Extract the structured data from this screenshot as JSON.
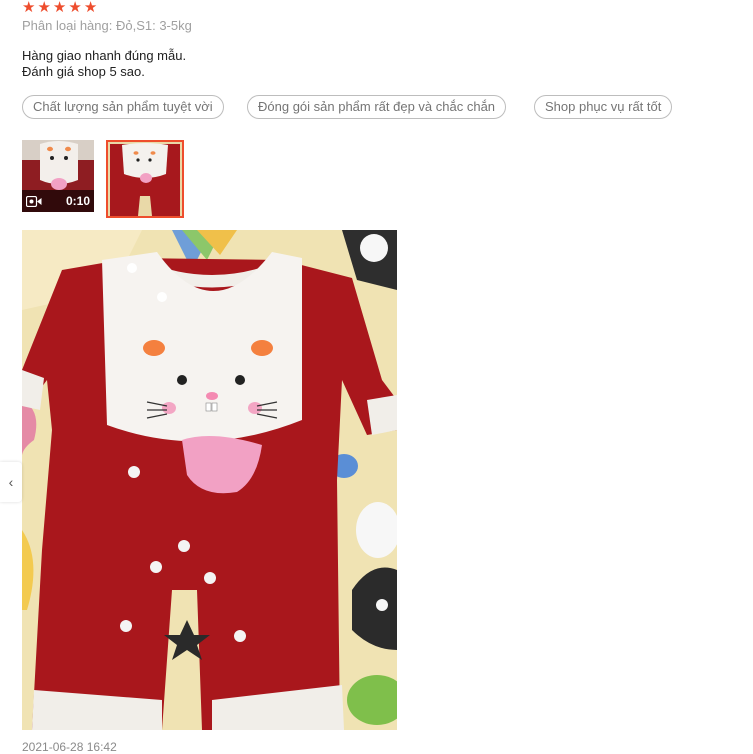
{
  "review": {
    "rating": 5,
    "stars": [
      "★",
      "★",
      "★",
      "★",
      "★"
    ],
    "variation": "Phân loại hàng: Đỏ,S1: 3-5kg",
    "comment_lines": [
      "Hàng giao nhanh đúng mẫu.",
      "Đánh giá shop 5 sao."
    ],
    "tags": [
      "Chất lượng sản phẩm tuyệt vời",
      "Đóng gói sản phẩm rất đẹp và chắc chắn",
      "Shop phục vụ rất tốt"
    ],
    "media": {
      "video_duration": "0:10",
      "video_icon": "video-camera-icon",
      "selected_index": 1
    },
    "prev_icon": "‹",
    "timestamp": "2021-06-28 16:42"
  },
  "colors": {
    "accent": "#ee4d2d",
    "onesie_red": "#b11a1a",
    "bib_white": "#f7f4f1",
    "text_muted": "#a0a0a0"
  }
}
